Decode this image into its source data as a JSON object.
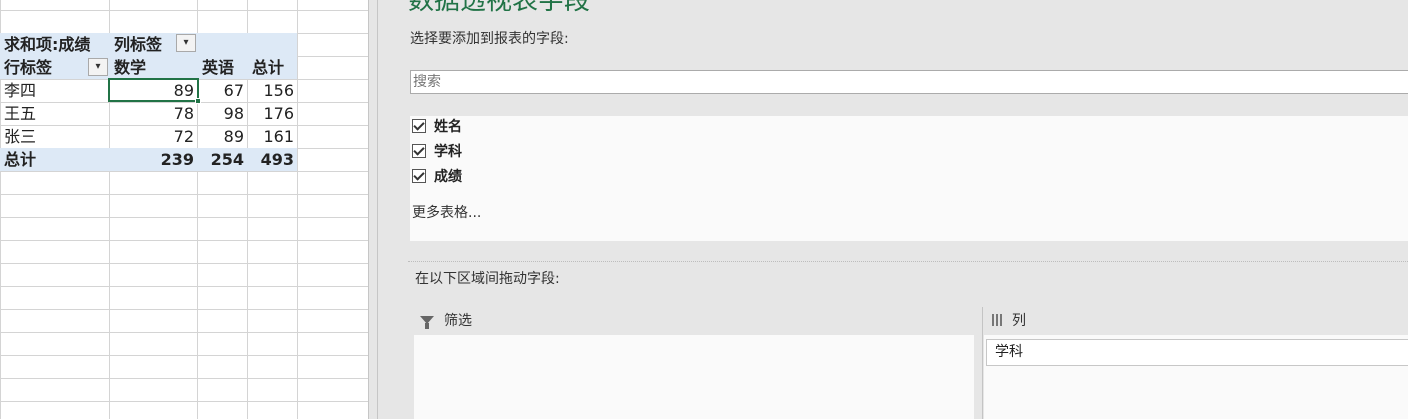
{
  "pivot": {
    "values_label": "求和项:成绩",
    "columns_label": "列标签",
    "rows_label": "行标签",
    "col_headers": [
      "数学",
      "英语",
      "总计"
    ],
    "rows": [
      {
        "name": "李四",
        "cells": [
          "89",
          "67",
          "156"
        ]
      },
      {
        "name": "王五",
        "cells": [
          "78",
          "98",
          "176"
        ]
      },
      {
        "name": "张三",
        "cells": [
          "72",
          "89",
          "161"
        ]
      }
    ],
    "total": {
      "name": "总计",
      "cells": [
        "239",
        "254",
        "493"
      ]
    }
  },
  "pane": {
    "title": "数据透视表字段",
    "choose_label": "选择要添加到报表的字段:",
    "search_placeholder": "搜索",
    "fields": [
      {
        "label": "姓名",
        "checked": true
      },
      {
        "label": "学科",
        "checked": true
      },
      {
        "label": "成绩",
        "checked": true
      }
    ],
    "more_tables": "更多表格...",
    "drag_label": "在以下区域间拖动字段:",
    "filter_area": {
      "label": "筛选",
      "icon": "funnel-icon"
    },
    "columns_area": {
      "label": "列",
      "icon": "columns-icon",
      "items": [
        "学科"
      ]
    }
  },
  "colors": {
    "accent": "#217346",
    "pivot_band": "#dde9f6"
  }
}
